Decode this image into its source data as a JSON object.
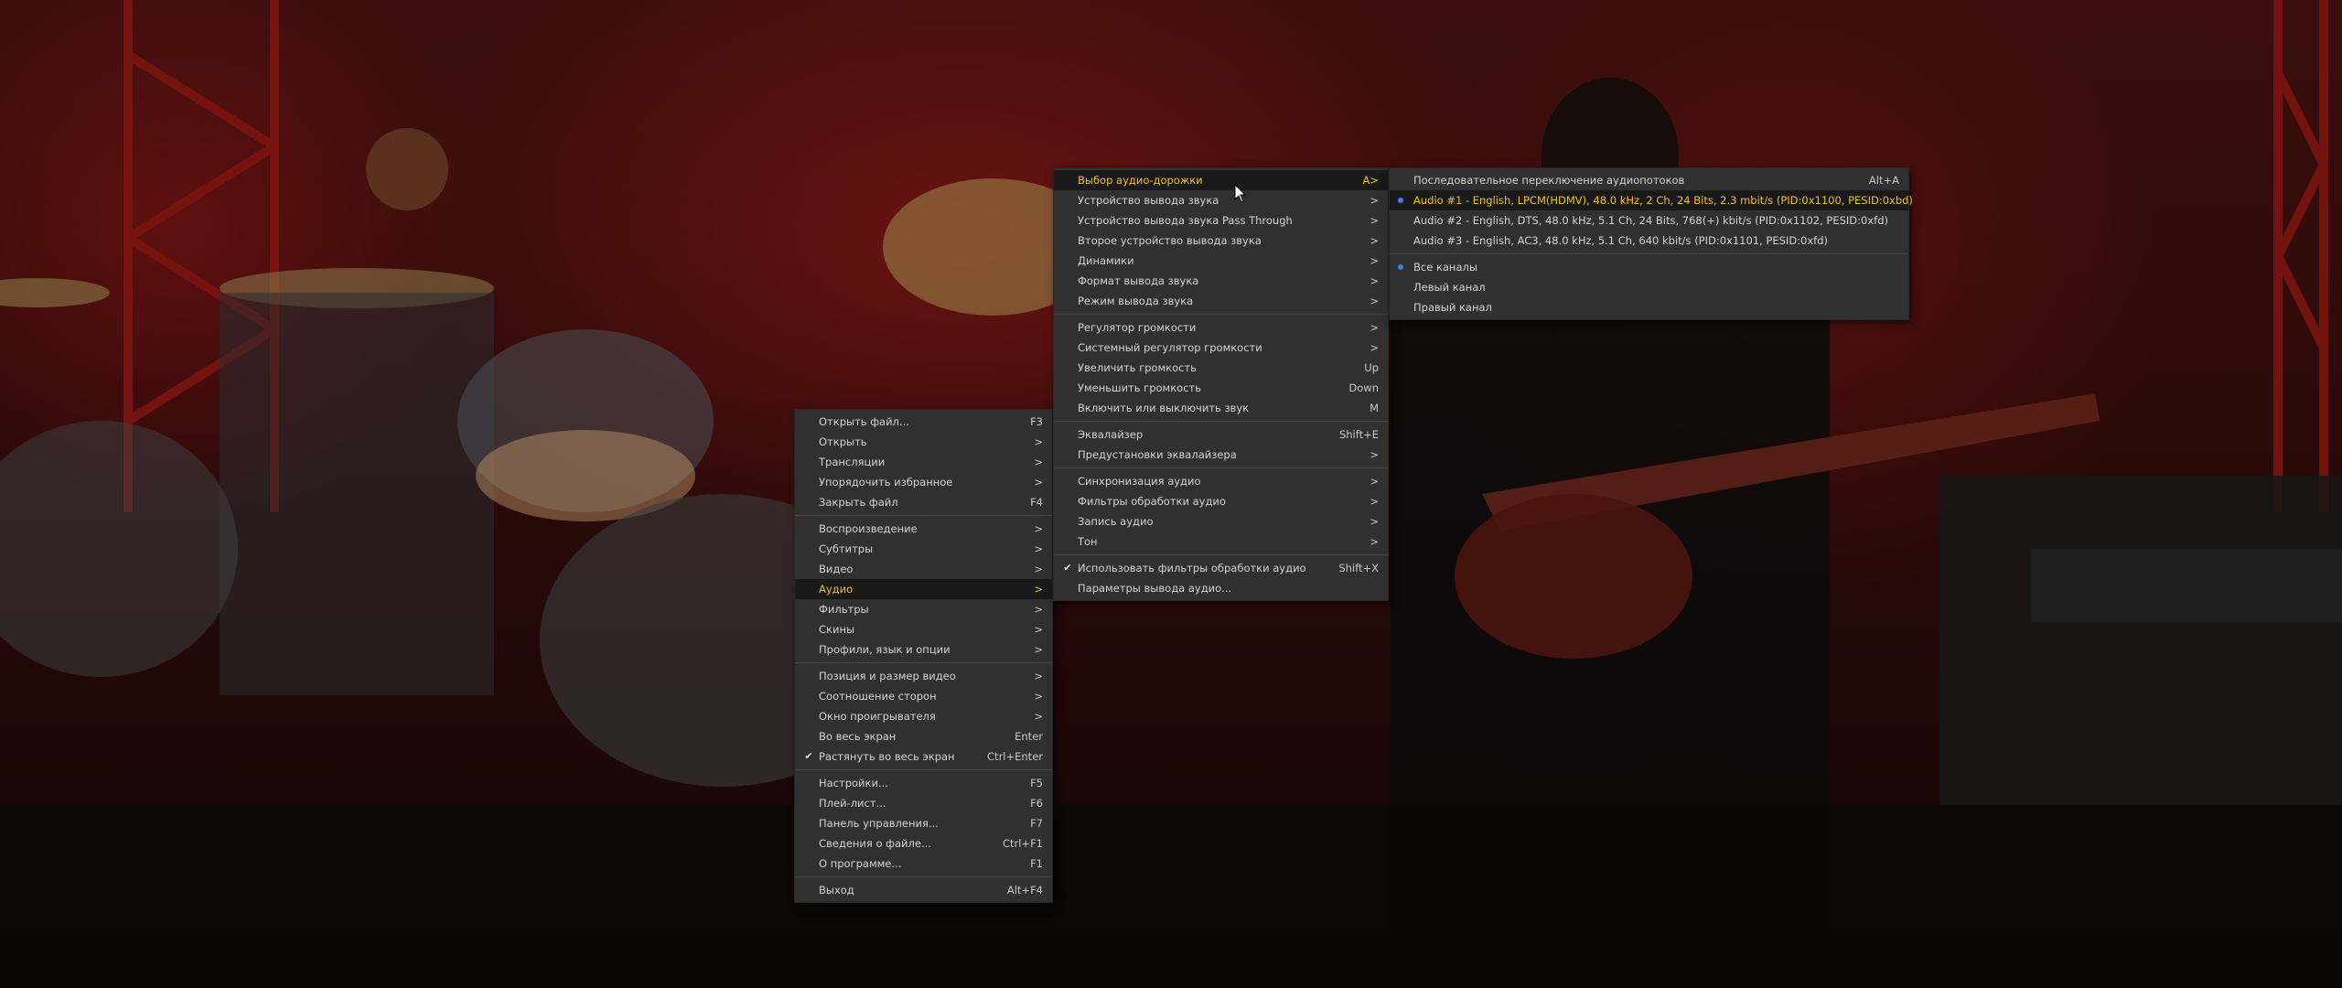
{
  "main_menu": {
    "items": [
      {
        "label": "Открыть файл...",
        "shortcut": "F3"
      },
      {
        "label": "Открыть",
        "shortcut": ">"
      },
      {
        "label": "Трансляции",
        "shortcut": ">"
      },
      {
        "label": "Упорядочить избранное",
        "shortcut": ">"
      },
      {
        "label": "Закрыть файл",
        "shortcut": "F4"
      },
      {
        "label": "Воспроизведение",
        "shortcut": ">"
      },
      {
        "label": "Субтитры",
        "shortcut": ">"
      },
      {
        "label": "Видео",
        "shortcut": ">"
      },
      {
        "label": "Аудио",
        "shortcut": ">"
      },
      {
        "label": "Фильтры",
        "shortcut": ">"
      },
      {
        "label": "Скины",
        "shortcut": ">"
      },
      {
        "label": "Профили, язык и опции",
        "shortcut": ">"
      },
      {
        "label": "Позиция и размер видео",
        "shortcut": ">"
      },
      {
        "label": "Соотношение сторон",
        "shortcut": ">"
      },
      {
        "label": "Окно проигрывателя",
        "shortcut": ">"
      },
      {
        "label": "Во весь экран",
        "shortcut": "Enter"
      },
      {
        "label": "Растянуть во весь экран",
        "shortcut": "Ctrl+Enter"
      },
      {
        "label": "Настройки...",
        "shortcut": "F5"
      },
      {
        "label": "Плей-лист...",
        "shortcut": "F6"
      },
      {
        "label": "Панель управления...",
        "shortcut": "F7"
      },
      {
        "label": "Сведения о файле...",
        "shortcut": "Ctrl+F1"
      },
      {
        "label": "О программе...",
        "shortcut": "F1"
      },
      {
        "label": "Выход",
        "shortcut": "Alt+F4"
      }
    ]
  },
  "audio_menu": {
    "items": [
      {
        "label": "Выбор аудио-дорожки",
        "shortcut": "A>"
      },
      {
        "label": "Устройство вывода звука",
        "shortcut": ">"
      },
      {
        "label": "Устройство вывода звука Pass Through",
        "shortcut": ">"
      },
      {
        "label": "Второе устройство вывода звука",
        "shortcut": ">"
      },
      {
        "label": "Динамики",
        "shortcut": ">"
      },
      {
        "label": "Формат вывода звука",
        "shortcut": ">"
      },
      {
        "label": "Режим вывода звука",
        "shortcut": ">"
      },
      {
        "label": "Регулятор громкости",
        "shortcut": ">"
      },
      {
        "label": "Системный регулятор громкости",
        "shortcut": ">"
      },
      {
        "label": "Увеличить громкость",
        "shortcut": "Up"
      },
      {
        "label": "Уменьшить громкость",
        "shortcut": "Down"
      },
      {
        "label": "Включить или выключить звук",
        "shortcut": "M"
      },
      {
        "label": "Эквалайзер",
        "shortcut": "Shift+E"
      },
      {
        "label": "Предустановки эквалайзера",
        "shortcut": ">"
      },
      {
        "label": "Синхронизация аудио",
        "shortcut": ">"
      },
      {
        "label": "Фильтры обработки аудио",
        "shortcut": ">"
      },
      {
        "label": "Запись аудио",
        "shortcut": ">"
      },
      {
        "label": "Тон",
        "shortcut": ">"
      },
      {
        "label": "Использовать фильтры обработки аудио",
        "shortcut": "Shift+X"
      },
      {
        "label": "Параметры вывода аудио...",
        "shortcut": ""
      }
    ]
  },
  "track_menu": {
    "items": [
      {
        "label": "Последовательное переключение аудиопотоков",
        "shortcut": "Alt+A"
      },
      {
        "label": "Audio #1 - English, LPCM(HDMV), 48.0 kHz, 2 Ch, 24 Bits, 2.3 mbit/s (PID:0x1100, PESID:0xbd)",
        "shortcut": ""
      },
      {
        "label": "Audio #2 - English, DTS, 48.0 kHz, 5.1 Ch, 24 Bits, 768(+) kbit/s (PID:0x1102, PESID:0xfd)",
        "shortcut": ""
      },
      {
        "label": "Audio #3 - English, AC3, 48.0 kHz, 5.1 Ch, 640 kbit/s (PID:0x1101, PESID:0xfd)",
        "shortcut": ""
      },
      {
        "label": "Все каналы",
        "shortcut": ""
      },
      {
        "label": "Левый канал",
        "shortcut": ""
      },
      {
        "label": "Правый канал",
        "shortcut": ""
      }
    ]
  },
  "icons": {
    "checkmark": "✔",
    "cursor": "arrow-cursor-icon"
  },
  "colors": {
    "highlight_text": "#f0c02a",
    "radio_dot": "#3f7fe8",
    "menu_bg": "#303030"
  }
}
